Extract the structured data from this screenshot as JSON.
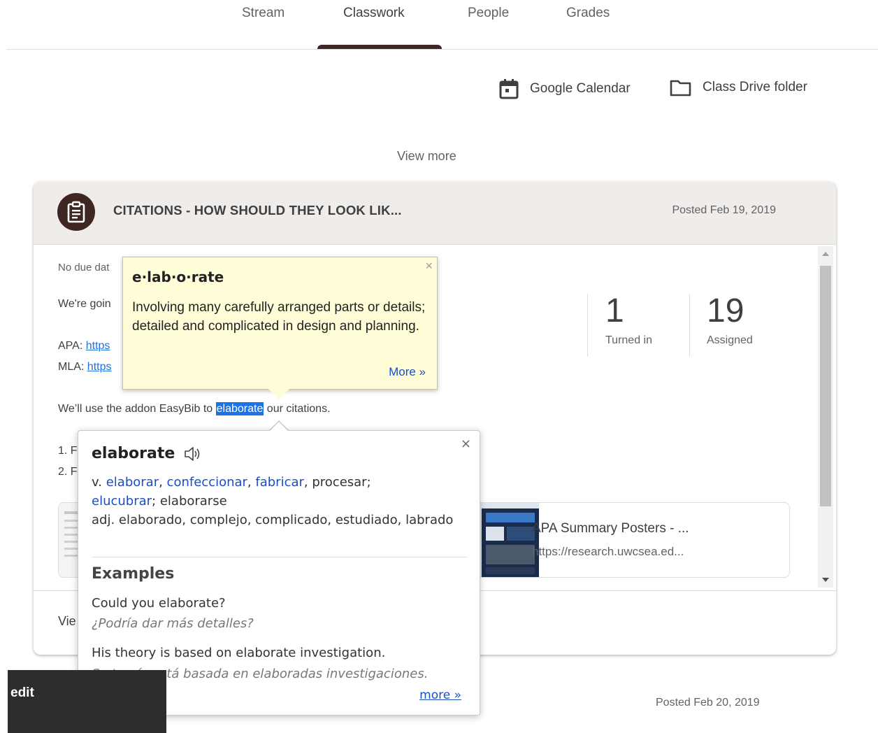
{
  "tabs": [
    {
      "label": "Stream"
    },
    {
      "label": "Classwork"
    },
    {
      "label": "People"
    },
    {
      "label": "Grades"
    }
  ],
  "links": {
    "calendar": "Google Calendar",
    "drive": "Class Drive folder"
  },
  "view_more": "View more",
  "card": {
    "title": "CITATIONS - HOW SHOULD THEY LOOK LIK...",
    "posted": "Posted Feb 19, 2019",
    "due": "No due dat",
    "intro": "We're goin",
    "apa_label": "APA:",
    "apa_link": "https",
    "mla_label": "MLA:",
    "mla_link": "https",
    "sentence_before": "We’ll use the addon EasyBib to",
    "sentence_highlight": "elaborate",
    "sentence_after": "our citations.",
    "list_1": "1. F",
    "list_2": "2. F",
    "stats": {
      "turned_in": "1",
      "turned_in_label": "Turned in",
      "assigned": "19",
      "assigned_label": "Assigned"
    },
    "attachment": {
      "title": "APA Summary Posters - ...",
      "url": "https://research.uwcsea.ed..."
    },
    "footer": "Vie"
  },
  "definition_popup": {
    "word": "e·lab·o·rate",
    "definition": "Involving many carefully arranged parts or details; detailed and complicated in design and planning.",
    "more": "More »",
    "close": "×"
  },
  "translation_popup": {
    "word": "elaborate",
    "close": "×",
    "verb_prefix": "v.",
    "verb_links": [
      "elaborar",
      "confeccionar",
      "fabricar"
    ],
    "verb_plain": "procesar;",
    "verb_link2": "elucubrar",
    "verb_rest": "; elaborarse",
    "adj": "adj. elaborado, complejo, complicado, estudiado, labrado",
    "examples_title": "Examples",
    "examples": [
      {
        "en": "Could you elaborate?",
        "es": "¿Podría dar más detalles?"
      },
      {
        "en": "His theory is based on elaborate investigation.",
        "es": "Su teoría está basada en elaboradas investigaciones."
      }
    ],
    "more": "more »"
  },
  "bottom": {
    "edit": "edit",
    "posted": "Posted Feb 20, 2019"
  },
  "colors": {
    "accent": "#3e2723",
    "link": "#1a73e8",
    "tooltip_bg": "#fffdd7"
  }
}
